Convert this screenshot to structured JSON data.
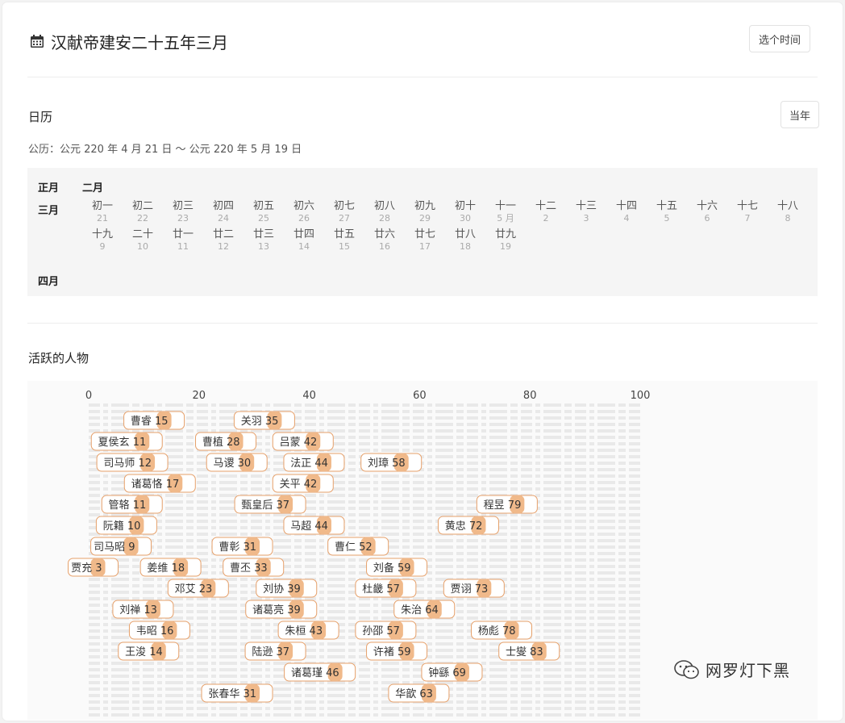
{
  "header": {
    "title": "汉献帝建安二十五年三月",
    "pick_time_label": "选个时间"
  },
  "calendar": {
    "title": "日历",
    "this_year_label": "当年",
    "gregorian_range": "公历：公元 220 年 4 月 21 日 ～ 公元 220 年 5 月 19 日",
    "months": [
      {
        "name": "正月",
        "days": []
      },
      {
        "name": "二月",
        "days": []
      },
      {
        "name": "三月",
        "days": [
          {
            "lunar": "初一",
            "solar": "21"
          },
          {
            "lunar": "初二",
            "solar": "22"
          },
          {
            "lunar": "初三",
            "solar": "23"
          },
          {
            "lunar": "初四",
            "solar": "24"
          },
          {
            "lunar": "初五",
            "solar": "25"
          },
          {
            "lunar": "初六",
            "solar": "26"
          },
          {
            "lunar": "初七",
            "solar": "27"
          },
          {
            "lunar": "初八",
            "solar": "28"
          },
          {
            "lunar": "初九",
            "solar": "29"
          },
          {
            "lunar": "初十",
            "solar": "30"
          },
          {
            "lunar": "十一",
            "solar": "5 月"
          },
          {
            "lunar": "十二",
            "solar": "2"
          },
          {
            "lunar": "十三",
            "solar": "3"
          },
          {
            "lunar": "十四",
            "solar": "4"
          },
          {
            "lunar": "十五",
            "solar": "5"
          },
          {
            "lunar": "十六",
            "solar": "6"
          },
          {
            "lunar": "十七",
            "solar": "7"
          },
          {
            "lunar": "十八",
            "solar": "8"
          },
          {
            "lunar": "十九",
            "solar": "9"
          },
          {
            "lunar": "二十",
            "solar": "10"
          },
          {
            "lunar": "廿一",
            "solar": "11"
          },
          {
            "lunar": "廿二",
            "solar": "12"
          },
          {
            "lunar": "廿三",
            "solar": "13"
          },
          {
            "lunar": "廿四",
            "solar": "14"
          },
          {
            "lunar": "廿五",
            "solar": "15"
          },
          {
            "lunar": "廿六",
            "solar": "16"
          },
          {
            "lunar": "廿七",
            "solar": "17"
          },
          {
            "lunar": "廿八",
            "solar": "18"
          },
          {
            "lunar": "廿九",
            "solar": "19"
          }
        ]
      },
      {
        "name": "四月",
        "days": []
      }
    ]
  },
  "characters": {
    "title": "活跃的人物"
  },
  "chart_data": {
    "type": "bar",
    "xlim": [
      0,
      100
    ],
    "x_ticks": [
      0,
      20,
      40,
      60,
      80,
      100
    ],
    "bar_color": "#f0b98a",
    "border_color": "#e6a06a",
    "grid": "dashed-stripes",
    "rows": [
      [
        {
          "name": "曹睿",
          "value": 15
        },
        {
          "name": "关羽",
          "value": 35
        }
      ],
      [
        {
          "name": "夏侯玄",
          "value": 11
        },
        {
          "name": "曹植",
          "value": 28
        },
        {
          "name": "吕蒙",
          "value": 42
        }
      ],
      [
        {
          "name": "司马师",
          "value": 12
        },
        {
          "name": "马谡",
          "value": 30
        },
        {
          "name": "法正",
          "value": 44
        },
        {
          "name": "刘璋",
          "value": 58
        }
      ],
      [
        {
          "name": "诸葛恪",
          "value": 17
        },
        {
          "name": "关平",
          "value": 42
        }
      ],
      [
        {
          "name": "管辂",
          "value": 11
        },
        {
          "name": "甄皇后",
          "value": 37
        },
        {
          "name": "程昱",
          "value": 79
        }
      ],
      [
        {
          "name": "阮籍",
          "value": 10
        },
        {
          "name": "马超",
          "value": 44
        },
        {
          "name": "黄忠",
          "value": 72
        }
      ],
      [
        {
          "name": "司马昭",
          "value": 9
        },
        {
          "name": "曹彰",
          "value": 31
        },
        {
          "name": "曹仁",
          "value": 52
        }
      ],
      [
        {
          "name": "贾充",
          "value": 3
        },
        {
          "name": "姜维",
          "value": 18
        },
        {
          "name": "曹丕",
          "value": 33
        },
        {
          "name": "刘备",
          "value": 59
        }
      ],
      [
        {
          "name": "邓艾",
          "value": 23
        },
        {
          "name": "刘协",
          "value": 39
        },
        {
          "name": "杜畿",
          "value": 57
        },
        {
          "name": "贾诩",
          "value": 73
        }
      ],
      [
        {
          "name": "刘禅",
          "value": 13
        },
        {
          "name": "诸葛亮",
          "value": 39
        },
        {
          "name": "朱治",
          "value": 64
        }
      ],
      [
        {
          "name": "韦昭",
          "value": 16
        },
        {
          "name": "朱桓",
          "value": 43
        },
        {
          "name": "孙邵",
          "value": 57
        },
        {
          "name": "杨彪",
          "value": 78
        }
      ],
      [
        {
          "name": "王浚",
          "value": 14
        },
        {
          "name": "陆逊",
          "value": 37
        },
        {
          "name": "许褚",
          "value": 59
        },
        {
          "name": "士燮",
          "value": 83
        }
      ],
      [
        {
          "name": "诸葛瑾",
          "value": 46
        },
        {
          "name": "钟繇",
          "value": 69
        }
      ],
      [
        {
          "name": "张春华",
          "value": 31
        },
        {
          "name": "华歆",
          "value": 63
        }
      ]
    ]
  },
  "watermark": {
    "text": "网罗灯下黑",
    "icon": "wechat-icon"
  }
}
